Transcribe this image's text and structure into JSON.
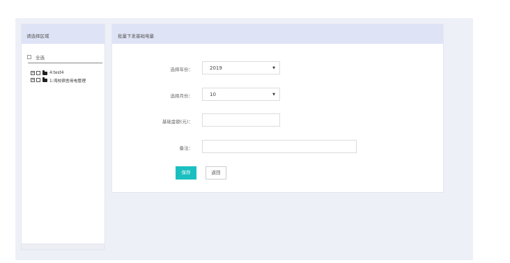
{
  "left_panel": {
    "title": "请选择区域",
    "select_all": "全选",
    "tree": [
      {
        "label": "4:test4"
      },
      {
        "label": "1:湾校宿舍用电管理"
      }
    ]
  },
  "right_panel": {
    "title": "批量下发基础电量",
    "fields": {
      "year_label": "选择年份：",
      "year_value": "2019",
      "month_label": "选择月份：",
      "month_value": "10",
      "amount_label": "基础金额(元)：",
      "remark_label": "备注："
    },
    "buttons": {
      "save": "保存",
      "back": "返回"
    }
  },
  "colors": {
    "header_bg": "#dfe3f6",
    "save_button": "#1bbfbf",
    "frame_bg": "#eef0f8"
  }
}
